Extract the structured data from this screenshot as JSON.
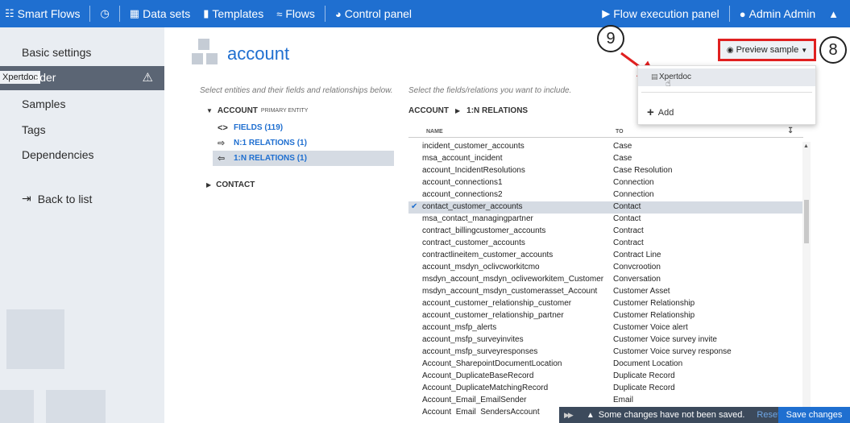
{
  "topbar": {
    "brand": "Smart Flows",
    "nav": [
      "Data sets",
      "Templates",
      "Flows",
      "Control panel"
    ],
    "flow_panel": "Flow execution panel",
    "user": "Admin Admin"
  },
  "sidebar": {
    "basic_settings": "Basic settings",
    "tooltip": "Xpertdoc",
    "builder": "ilder",
    "samples": "Samples",
    "tags": "Tags",
    "dependencies": "Dependencies",
    "back": "Back to list"
  },
  "main": {
    "title": "account",
    "hint_left": "Select entities and their fields and relationships below.",
    "hint_right": "Select the fields/relations you want to include.",
    "tree": {
      "root": "ACCOUNT",
      "root_sub": "PRIMARY ENTITY",
      "fields": "FIELDS (119)",
      "n1": "N:1 RELATIONS (1)",
      "1n": "1:N RELATIONS (1)",
      "contact": "CONTACT"
    },
    "crumb": {
      "a": "ACCOUNT",
      "b": "1:N RELATIONS"
    },
    "col_name": "NAME",
    "col_to": "TO",
    "rows": [
      {
        "name": "incident_customer_accounts",
        "to": "Case"
      },
      {
        "name": "msa_account_incident",
        "to": "Case"
      },
      {
        "name": "account_IncidentResolutions",
        "to": "Case Resolution"
      },
      {
        "name": "account_connections1",
        "to": "Connection"
      },
      {
        "name": "account_connections2",
        "to": "Connection"
      },
      {
        "name": "contact_customer_accounts",
        "to": "Contact"
      },
      {
        "name": "msa_contact_managingpartner",
        "to": "Contact"
      },
      {
        "name": "contract_billingcustomer_accounts",
        "to": "Contract"
      },
      {
        "name": "contract_customer_accounts",
        "to": "Contract"
      },
      {
        "name": "contractlineitem_customer_accounts",
        "to": "Contract Line"
      },
      {
        "name": "account_msdyn_oclivcworkitcmo",
        "to": "Convcrootion"
      },
      {
        "name": "msdyn_account_msdyn_ocliveworkitem_Customer",
        "to": "Conversation"
      },
      {
        "name": "msdyn_account_msdyn_customerasset_Account",
        "to": "Customer Asset"
      },
      {
        "name": "account_customer_relationship_customer",
        "to": "Customer Relationship"
      },
      {
        "name": "account_customer_relationship_partner",
        "to": "Customer Relationship"
      },
      {
        "name": "account_msfp_alerts",
        "to": "Customer Voice alert"
      },
      {
        "name": "account_msfp_surveyinvites",
        "to": "Customer Voice survey invite"
      },
      {
        "name": "account_msfp_surveyresponses",
        "to": "Customer Voice survey response"
      },
      {
        "name": "Account_SharepointDocumentLocation",
        "to": "Document Location"
      },
      {
        "name": "Account_DuplicateBaseRecord",
        "to": "Duplicate Record"
      },
      {
        "name": "Account_DuplicateMatchingRecord",
        "to": "Duplicate Record"
      },
      {
        "name": "Account_Email_EmailSender",
        "to": "Email"
      },
      {
        "name": "Account_Email_SendersAccount",
        "to": ""
      }
    ],
    "selected_row": 5
  },
  "preview": {
    "label": "Preview sample",
    "menu_item": "Xpertdoc",
    "add": "Add"
  },
  "callouts": {
    "nine": "9",
    "eight": "8"
  },
  "notification": {
    "message": "Some changes have not been saved.",
    "reset": "Reset",
    "save": "Save changes"
  },
  "colors": {
    "accent": "#1f6fd0",
    "highlight": "#e02020"
  }
}
